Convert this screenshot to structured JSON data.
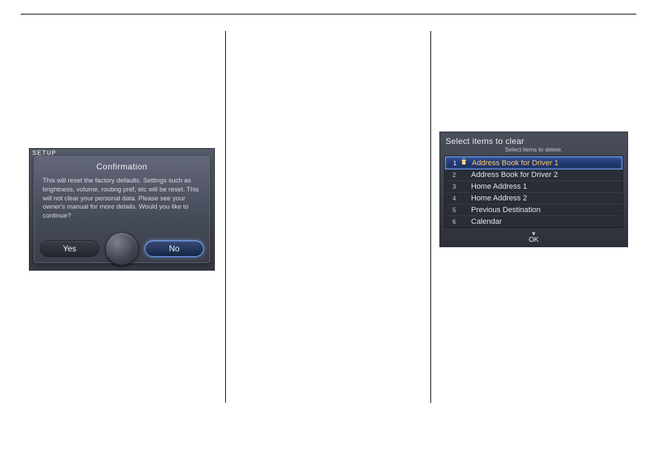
{
  "left": {
    "corner_label": "SETUP",
    "dialog": {
      "title": "Confirmation",
      "body": "This will reset the factory defaults. Settings such as brightness, volume, routing pref, etc will be reset. This will not clear your personal data. Please see your owner's manual for more details. Would you like to continue?",
      "yes": "Yes",
      "no": "No",
      "selected": "no"
    }
  },
  "right": {
    "title": "Select items to clear",
    "subtitle": "Select items to delete.",
    "ok_label": "OK",
    "items": [
      {
        "n": "1",
        "label": "Address Book for Driver 1",
        "selected": true,
        "trash": true
      },
      {
        "n": "2",
        "label": "Address Book for Driver 2",
        "selected": false,
        "trash": false
      },
      {
        "n": "3",
        "label": "Home Address 1",
        "selected": false,
        "trash": false
      },
      {
        "n": "4",
        "label": "Home Address 2",
        "selected": false,
        "trash": false
      },
      {
        "n": "5",
        "label": "Previous Destination",
        "selected": false,
        "trash": false
      },
      {
        "n": "6",
        "label": "Calendar",
        "selected": false,
        "trash": false
      }
    ]
  }
}
